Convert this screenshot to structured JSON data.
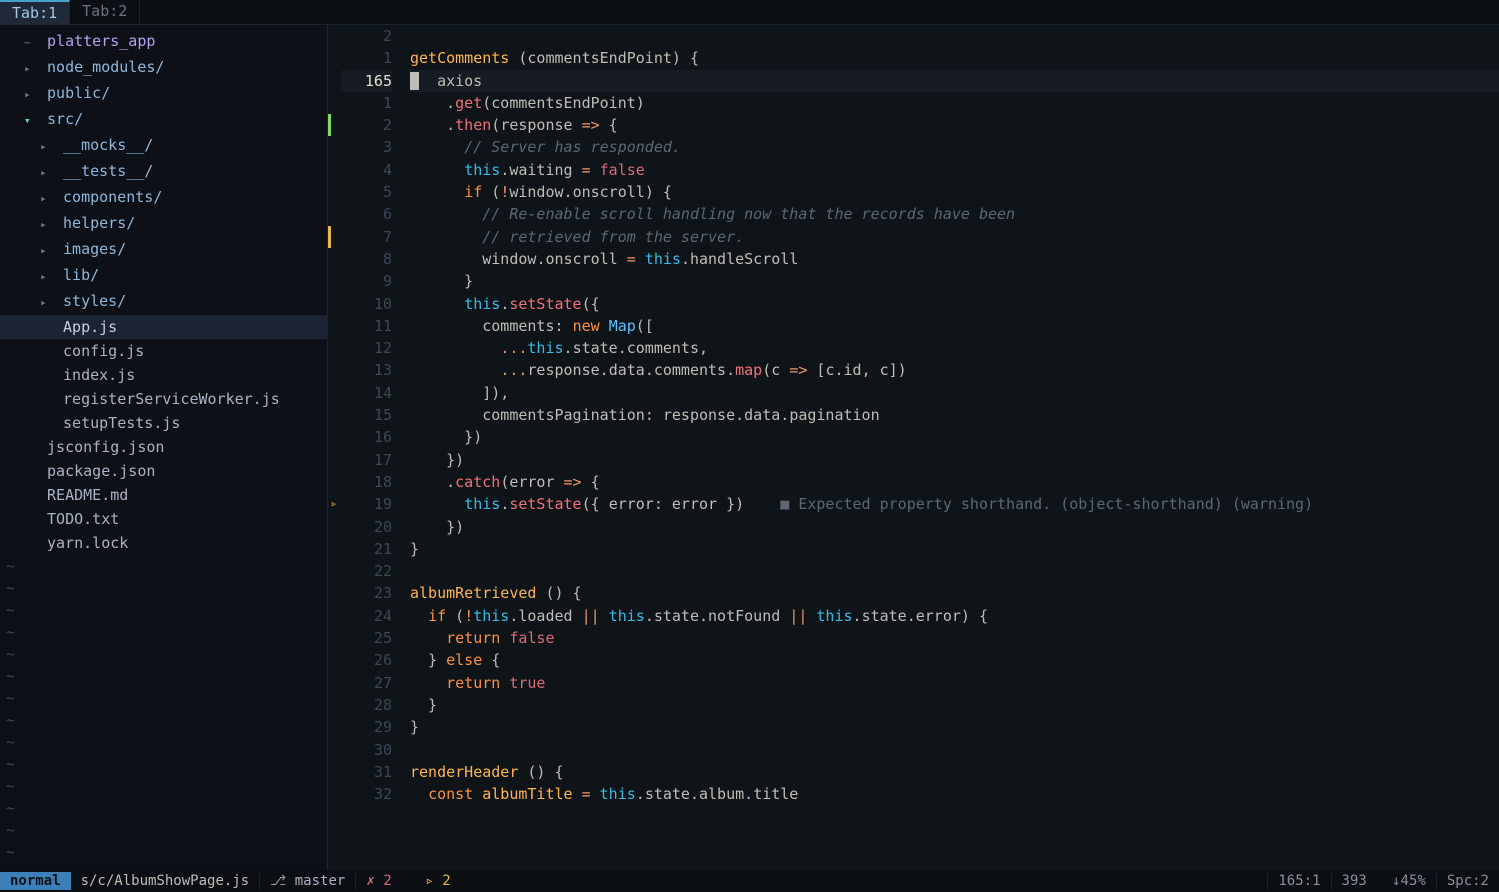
{
  "tabs": [
    {
      "label": "Tab:1",
      "active": true
    },
    {
      "label": "Tab:2",
      "active": false
    }
  ],
  "tree": [
    {
      "depth": 1,
      "icon": "home",
      "text": "platters_app",
      "cls": "root"
    },
    {
      "depth": 1,
      "icon": "closed",
      "text": "node_modules/",
      "cls": "dir"
    },
    {
      "depth": 1,
      "icon": "closed",
      "text": "public/",
      "cls": "dir"
    },
    {
      "depth": 1,
      "icon": "open",
      "text": "src/",
      "cls": "dir"
    },
    {
      "depth": 2,
      "icon": "closed",
      "text": "__mocks__/",
      "cls": "dir"
    },
    {
      "depth": 2,
      "icon": "closed",
      "text": "__tests__/",
      "cls": "dir"
    },
    {
      "depth": 2,
      "icon": "closed",
      "text": "components/",
      "cls": "dir"
    },
    {
      "depth": 2,
      "icon": "closed",
      "text": "helpers/",
      "cls": "dir"
    },
    {
      "depth": 2,
      "icon": "closed",
      "text": "images/",
      "cls": "dir"
    },
    {
      "depth": 2,
      "icon": "closed",
      "text": "lib/",
      "cls": "dir"
    },
    {
      "depth": 2,
      "icon": "closed",
      "text": "styles/",
      "cls": "dir"
    },
    {
      "depth": 2,
      "icon": "file",
      "text": "App.js",
      "cls": "file",
      "selected": true
    },
    {
      "depth": 2,
      "icon": "file",
      "text": "config.js",
      "cls": "file"
    },
    {
      "depth": 2,
      "icon": "file",
      "text": "index.js",
      "cls": "file"
    },
    {
      "depth": 2,
      "icon": "file",
      "text": "registerServiceWorker.js",
      "cls": "file"
    },
    {
      "depth": 2,
      "icon": "file",
      "text": "setupTests.js",
      "cls": "file"
    },
    {
      "depth": 1,
      "icon": "file",
      "text": "jsconfig.json",
      "cls": "file"
    },
    {
      "depth": 1,
      "icon": "file",
      "text": "package.json",
      "cls": "file"
    },
    {
      "depth": 1,
      "icon": "file",
      "text": "README.md",
      "cls": "file"
    },
    {
      "depth": 1,
      "icon": "file",
      "text": "TODO.txt",
      "cls": "file"
    },
    {
      "depth": 1,
      "icon": "file",
      "text": "yarn.lock",
      "cls": "file"
    }
  ],
  "gutter": [
    "2",
    "1",
    "165",
    "1",
    "2",
    "3",
    "4",
    "5",
    "6",
    "7",
    "8",
    "9",
    "10",
    "11",
    "12",
    "13",
    "14",
    "15",
    "16",
    "17",
    "18",
    "19",
    "20",
    "21",
    "22",
    "23",
    "24",
    "25",
    "26",
    "27",
    "28",
    "29",
    "30",
    "31",
    "32"
  ],
  "current_line_idx": 2,
  "signs": {
    "4": "git-add",
    "9": "git-mod",
    "21": "warn"
  },
  "code_lines": [
    {
      "tokens": []
    },
    {
      "tokens": [
        [
          "fn",
          "getComments"
        ],
        [
          "pn",
          " ("
        ],
        [
          "id",
          "commentsEndPoint"
        ],
        [
          "pn",
          ") {"
        ]
      ]
    },
    {
      "cursor": true,
      "tokens": [
        [
          "pn",
          "  "
        ],
        [
          "id",
          "axios"
        ]
      ]
    },
    {
      "tokens": [
        [
          "pn",
          "    ."
        ],
        [
          "mt",
          "get"
        ],
        [
          "pn",
          "("
        ],
        [
          "id",
          "commentsEndPoint"
        ],
        [
          "pn",
          ")"
        ]
      ]
    },
    {
      "tokens": [
        [
          "pn",
          "    ."
        ],
        [
          "mt",
          "then"
        ],
        [
          "pn",
          "("
        ],
        [
          "id",
          "response"
        ],
        [
          "pn",
          " "
        ],
        [
          "op",
          "=>"
        ],
        [
          "pn",
          " {"
        ]
      ]
    },
    {
      "tokens": [
        [
          "pn",
          "      "
        ],
        [
          "cm",
          "// Server has responded."
        ]
      ]
    },
    {
      "tokens": [
        [
          "pn",
          "      "
        ],
        [
          "th",
          "this"
        ],
        [
          "pn",
          "."
        ],
        [
          "pr",
          "waiting"
        ],
        [
          "pn",
          " "
        ],
        [
          "op",
          "="
        ],
        [
          "pn",
          " "
        ],
        [
          "bl",
          "false"
        ]
      ]
    },
    {
      "tokens": [
        [
          "pn",
          "      "
        ],
        [
          "kw",
          "if"
        ],
        [
          "pn",
          " ("
        ],
        [
          "op",
          "!"
        ],
        [
          "id",
          "window"
        ],
        [
          "pn",
          "."
        ],
        [
          "pr",
          "onscroll"
        ],
        [
          "pn",
          ") {"
        ]
      ]
    },
    {
      "tokens": [
        [
          "pn",
          "        "
        ],
        [
          "cm",
          "// Re-enable scroll handling now that the records have been"
        ]
      ]
    },
    {
      "tokens": [
        [
          "pn",
          "        "
        ],
        [
          "cm",
          "// retrieved from the server."
        ]
      ]
    },
    {
      "tokens": [
        [
          "pn",
          "        "
        ],
        [
          "id",
          "window"
        ],
        [
          "pn",
          "."
        ],
        [
          "pr",
          "onscroll"
        ],
        [
          "pn",
          " "
        ],
        [
          "op",
          "="
        ],
        [
          "pn",
          " "
        ],
        [
          "th",
          "this"
        ],
        [
          "pn",
          "."
        ],
        [
          "pr",
          "handleScroll"
        ]
      ]
    },
    {
      "tokens": [
        [
          "pn",
          "      }"
        ]
      ]
    },
    {
      "tokens": [
        [
          "pn",
          "      "
        ],
        [
          "th",
          "this"
        ],
        [
          "pn",
          "."
        ],
        [
          "mt",
          "setState"
        ],
        [
          "pn",
          "({"
        ]
      ]
    },
    {
      "tokens": [
        [
          "pn",
          "        "
        ],
        [
          "pr",
          "comments"
        ],
        [
          "pn",
          ": "
        ],
        [
          "kw",
          "new"
        ],
        [
          "pn",
          " "
        ],
        [
          "ty",
          "Map"
        ],
        [
          "pn",
          "(["
        ]
      ]
    },
    {
      "tokens": [
        [
          "pn",
          "          "
        ],
        [
          "op",
          "..."
        ],
        [
          "th",
          "this"
        ],
        [
          "pn",
          "."
        ],
        [
          "pr",
          "state"
        ],
        [
          "pn",
          "."
        ],
        [
          "pr",
          "comments"
        ],
        [
          "pn",
          ","
        ]
      ]
    },
    {
      "tokens": [
        [
          "pn",
          "          "
        ],
        [
          "op",
          "..."
        ],
        [
          "id",
          "response"
        ],
        [
          "pn",
          "."
        ],
        [
          "pr",
          "data"
        ],
        [
          "pn",
          "."
        ],
        [
          "pr",
          "comments"
        ],
        [
          "pn",
          "."
        ],
        [
          "mt",
          "map"
        ],
        [
          "pn",
          "("
        ],
        [
          "id",
          "c"
        ],
        [
          "pn",
          " "
        ],
        [
          "op",
          "=>"
        ],
        [
          "pn",
          " ["
        ],
        [
          "id",
          "c"
        ],
        [
          "pn",
          "."
        ],
        [
          "pr",
          "id"
        ],
        [
          "pn",
          ", "
        ],
        [
          "id",
          "c"
        ],
        [
          "pn",
          "])"
        ]
      ]
    },
    {
      "tokens": [
        [
          "pn",
          "        ]),"
        ]
      ]
    },
    {
      "tokens": [
        [
          "pn",
          "        "
        ],
        [
          "pr",
          "commentsPagination"
        ],
        [
          "pn",
          ": "
        ],
        [
          "id",
          "response"
        ],
        [
          "pn",
          "."
        ],
        [
          "pr",
          "data"
        ],
        [
          "pn",
          "."
        ],
        [
          "pr",
          "pagination"
        ]
      ]
    },
    {
      "tokens": [
        [
          "pn",
          "      })"
        ]
      ]
    },
    {
      "tokens": [
        [
          "pn",
          "    })"
        ]
      ]
    },
    {
      "tokens": [
        [
          "pn",
          "    ."
        ],
        [
          "mt",
          "catch"
        ],
        [
          "pn",
          "("
        ],
        [
          "id",
          "error"
        ],
        [
          "pn",
          " "
        ],
        [
          "op",
          "=>"
        ],
        [
          "pn",
          " {"
        ]
      ]
    },
    {
      "tokens": [
        [
          "pn",
          "      "
        ],
        [
          "th",
          "this"
        ],
        [
          "pn",
          "."
        ],
        [
          "mt",
          "setState"
        ],
        [
          "pn",
          "({ "
        ],
        [
          "pr",
          "error"
        ],
        [
          "pn",
          ": "
        ],
        [
          "id",
          "error"
        ],
        [
          "pn",
          " })"
        ],
        [
          "diag",
          "    "
        ],
        [
          "diag-sq",
          "■ "
        ],
        [
          "diag",
          "Expected property shorthand. (object-shorthand) (warning)"
        ]
      ]
    },
    {
      "tokens": [
        [
          "pn",
          "    })"
        ]
      ]
    },
    {
      "tokens": [
        [
          "pn",
          "}"
        ]
      ]
    },
    {
      "tokens": []
    },
    {
      "tokens": [
        [
          "fn",
          "albumRetrieved"
        ],
        [
          "pn",
          " () {"
        ]
      ]
    },
    {
      "tokens": [
        [
          "pn",
          "  "
        ],
        [
          "kw",
          "if"
        ],
        [
          "pn",
          " ("
        ],
        [
          "op",
          "!"
        ],
        [
          "th",
          "this"
        ],
        [
          "pn",
          "."
        ],
        [
          "pr",
          "loaded"
        ],
        [
          "pn",
          " "
        ],
        [
          "op",
          "||"
        ],
        [
          "pn",
          " "
        ],
        [
          "th",
          "this"
        ],
        [
          "pn",
          "."
        ],
        [
          "pr",
          "state"
        ],
        [
          "pn",
          "."
        ],
        [
          "pr",
          "notFound"
        ],
        [
          "pn",
          " "
        ],
        [
          "op",
          "||"
        ],
        [
          "pn",
          " "
        ],
        [
          "th",
          "this"
        ],
        [
          "pn",
          "."
        ],
        [
          "pr",
          "state"
        ],
        [
          "pn",
          "."
        ],
        [
          "pr",
          "error"
        ],
        [
          "pn",
          ") {"
        ]
      ]
    },
    {
      "tokens": [
        [
          "pn",
          "    "
        ],
        [
          "kw",
          "return"
        ],
        [
          "pn",
          " "
        ],
        [
          "bl",
          "false"
        ]
      ]
    },
    {
      "tokens": [
        [
          "pn",
          "  } "
        ],
        [
          "kw",
          "else"
        ],
        [
          "pn",
          " {"
        ]
      ]
    },
    {
      "tokens": [
        [
          "pn",
          "    "
        ],
        [
          "kw",
          "return"
        ],
        [
          "pn",
          " "
        ],
        [
          "bl",
          "true"
        ]
      ]
    },
    {
      "tokens": [
        [
          "pn",
          "  }"
        ]
      ]
    },
    {
      "tokens": [
        [
          "pn",
          "}"
        ]
      ]
    },
    {
      "tokens": []
    },
    {
      "tokens": [
        [
          "fn",
          "renderHeader"
        ],
        [
          "pn",
          " () {"
        ]
      ]
    },
    {
      "tokens": [
        [
          "pn",
          "  "
        ],
        [
          "kw",
          "const"
        ],
        [
          "pn",
          " "
        ],
        [
          "cn",
          "albumTitle"
        ],
        [
          "pn",
          " "
        ],
        [
          "op",
          "="
        ],
        [
          "pn",
          " "
        ],
        [
          "th",
          "this"
        ],
        [
          "pn",
          "."
        ],
        [
          "pr",
          "state"
        ],
        [
          "pn",
          "."
        ],
        [
          "pr",
          "album"
        ],
        [
          "pn",
          "."
        ],
        [
          "pr",
          "title"
        ]
      ]
    }
  ],
  "status": {
    "mode": "normal",
    "file": "s/c/AlbumShowPage.js",
    "branch_icon": "⎇",
    "branch": "master",
    "err_icon": "✗",
    "err_count": "2",
    "warn_icon": "▹",
    "warn_count": "2",
    "pos": "165:1",
    "total": "393",
    "scroll": "↓45%",
    "indent": "Spc:2"
  }
}
